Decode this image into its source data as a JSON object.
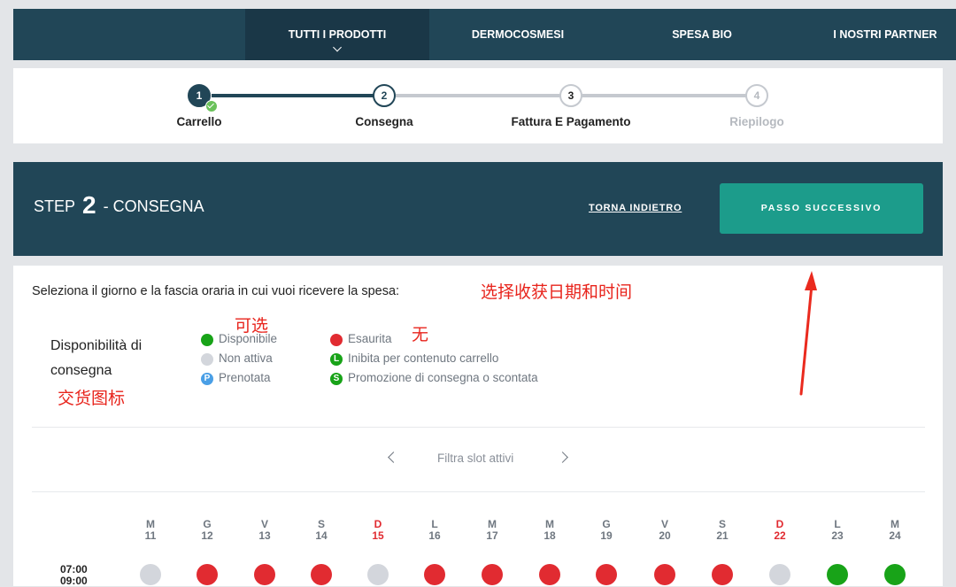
{
  "nav": {
    "items": [
      {
        "label": "TUTTI I PRODOTTI",
        "active": true
      },
      {
        "label": "DERMOCOSMESI"
      },
      {
        "label": "SPESA BIO"
      },
      {
        "label": "I NOSTRI PARTNER"
      }
    ]
  },
  "stepper": {
    "steps": [
      {
        "num": "1",
        "label": "Carrello",
        "state": "done"
      },
      {
        "num": "2",
        "label": "Consegna",
        "state": "current"
      },
      {
        "num": "3",
        "label": "Fattura E Pagamento",
        "state": "todo"
      },
      {
        "num": "4",
        "label": "Riepilogo",
        "state": "disabled"
      }
    ]
  },
  "header": {
    "step_word": "STEP",
    "step_num": "2",
    "step_title": "- CONSEGNA",
    "back_label": "TORNA INDIETRO",
    "next_label": "PASSO SUCCESSIVO"
  },
  "content": {
    "instruction": "Seleziona il giorno e la fascia oraria in cui vuoi ricevere la spesa:",
    "legend_title_1": "Disponibilità di",
    "legend_title_2": "consegna",
    "legend": {
      "disponibile": "Disponibile",
      "non_attiva": "Non attiva",
      "prenotata": "Prenotata",
      "esaurita": "Esaurita",
      "inibita": "Inibita per contenuto carrello",
      "promozione": "Promozione di consegna o scontata",
      "badge_p": "P",
      "badge_l": "L",
      "badge_s": "S"
    },
    "filter_label": "Filtra slot attivi",
    "days": [
      {
        "letter": "M",
        "num": "11",
        "red": false
      },
      {
        "letter": "G",
        "num": "12",
        "red": false
      },
      {
        "letter": "V",
        "num": "13",
        "red": false
      },
      {
        "letter": "S",
        "num": "14",
        "red": false
      },
      {
        "letter": "D",
        "num": "15",
        "red": true
      },
      {
        "letter": "L",
        "num": "16",
        "red": false
      },
      {
        "letter": "M",
        "num": "17",
        "red": false
      },
      {
        "letter": "M",
        "num": "18",
        "red": false
      },
      {
        "letter": "G",
        "num": "19",
        "red": false
      },
      {
        "letter": "V",
        "num": "20",
        "red": false
      },
      {
        "letter": "S",
        "num": "21",
        "red": false
      },
      {
        "letter": "D",
        "num": "22",
        "red": true
      },
      {
        "letter": "L",
        "num": "23",
        "red": false
      },
      {
        "letter": "M",
        "num": "24",
        "red": false
      }
    ],
    "time_start": "07:00",
    "time_end": "09:00",
    "slots": [
      "grey",
      "red",
      "red",
      "red",
      "grey",
      "red",
      "red",
      "red",
      "red",
      "red",
      "red",
      "grey",
      "green",
      "green"
    ]
  },
  "annotations": {
    "select_date": "选择收获日期和时间",
    "available": "可选",
    "none": "无",
    "delivery_icons": "交货图标"
  },
  "colors": {
    "navy": "#214657",
    "teal": "#1c9c8b",
    "red": "#e12b31",
    "green": "#18a318",
    "grey": "#d3d6dc",
    "blue": "#4a9fe6"
  }
}
